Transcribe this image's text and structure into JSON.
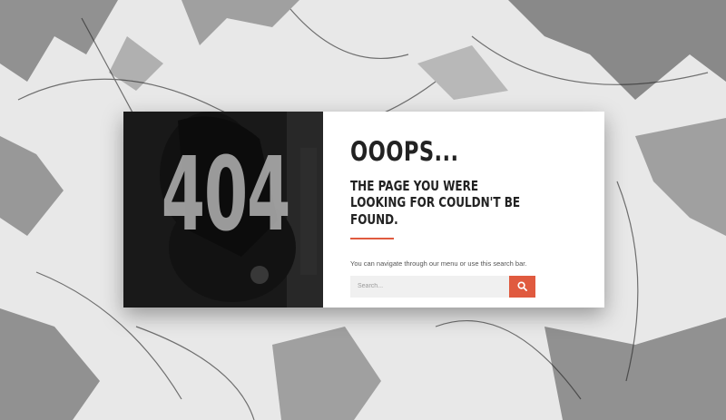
{
  "error": {
    "code": "404",
    "headline": "OOOPS...",
    "message": "THE PAGE YOU WERE LOOKING FOR COULDN'T BE FOUND.",
    "hint": "You can navigate through our menu or use this search bar."
  },
  "search": {
    "placeholder": "Search...",
    "button_icon": "search-icon"
  },
  "colors": {
    "accent": "#e05a3f",
    "card_bg": "#ffffff",
    "text": "#222222",
    "photo_bg": "#1f1f1f"
  }
}
